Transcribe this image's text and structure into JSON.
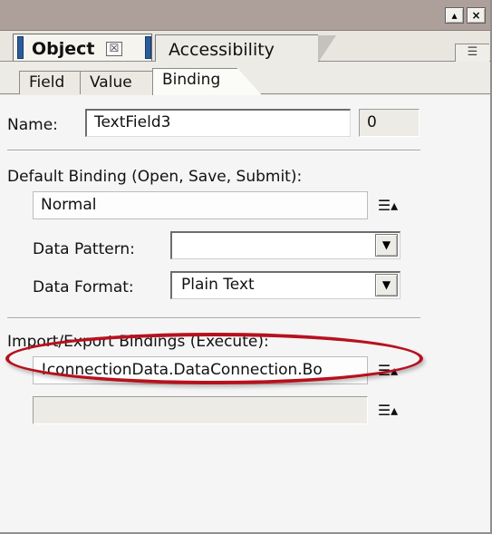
{
  "window": {
    "buttons": [
      "▴",
      "×"
    ]
  },
  "tabs": {
    "object": "Object",
    "accessibility": "Accessibility",
    "close_glyph": "☒",
    "menu_glyph": "☰"
  },
  "inner_tabs": [
    "Field",
    "Value",
    "Binding"
  ],
  "fields": {
    "name_label": "Name:",
    "name_value": "TextField3",
    "index_value": "0",
    "default_binding_label": "Default Binding (Open, Save, Submit):",
    "default_binding_value": "Normal",
    "data_pattern_label": "Data Pattern:",
    "data_pattern_value": "",
    "data_format_label": "Data Format:",
    "data_format_value": "Plain Text",
    "import_export_label": "Import/Export Bindings (Execute):",
    "binding_1": "!connectionData.DataConnection.Bo",
    "binding_2": ""
  },
  "icons": {
    "list_menu": "☰▴"
  },
  "colors": {
    "annotation": "#b7111d",
    "tab_handle": "#2c5b9a"
  }
}
